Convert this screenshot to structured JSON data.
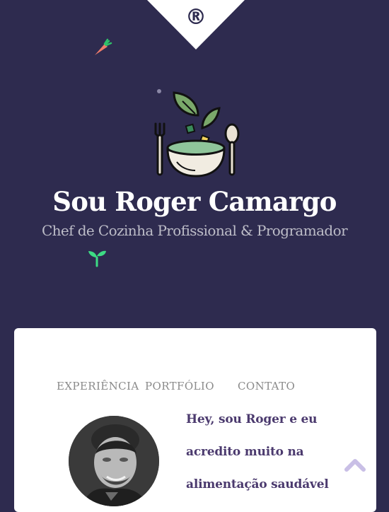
{
  "logo": {
    "mark": "®",
    "icon": "registered-mark"
  },
  "hero": {
    "title": "Sou Roger Camargo",
    "subtitle": "Chef de Cozinha Profissional & Programador",
    "logo_icon": "salad-bowl-icon",
    "decorations": [
      "carrot-icon",
      "sprout-icon"
    ]
  },
  "nav": {
    "items": [
      {
        "label": "EXPERIÊNCIA"
      },
      {
        "label": "PORTFÓLIO"
      },
      {
        "label": "CONTATO"
      }
    ]
  },
  "about": {
    "lines": [
      "Hey, sou Roger e eu",
      "acredito muito na",
      "alimentação saudável"
    ],
    "avatar_icon": "profile-photo"
  },
  "scroll_top_icon": "chevron-up-icon",
  "colors": {
    "background": "#2e2b4f",
    "card": "#ffffff",
    "accent_text": "#4b3a6e",
    "nav_text": "#8a8a8a",
    "scroll_icon": "#c9bfe6"
  }
}
